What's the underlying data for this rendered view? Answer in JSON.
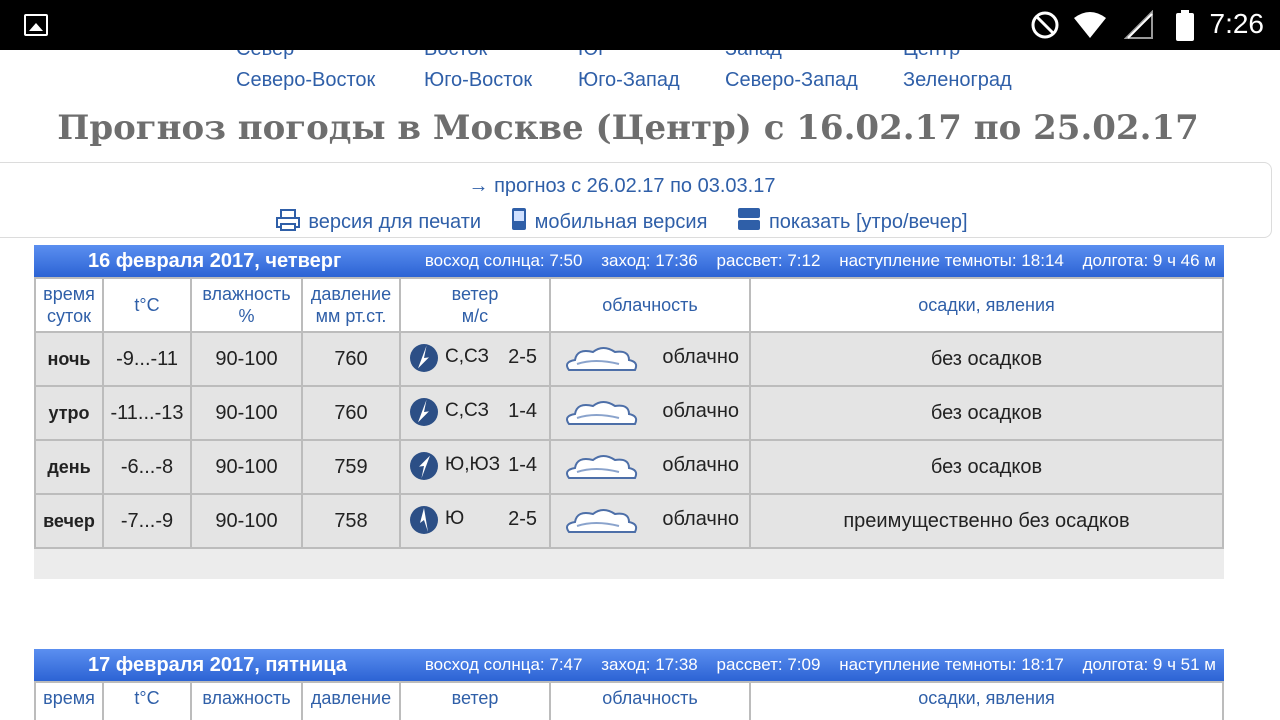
{
  "statusbar": {
    "time": "7:26"
  },
  "districts": [
    "Север",
    "Восток",
    "Юг",
    "Запад",
    "Центр",
    "Северо-Восток",
    "Юго-Восток",
    "Юго-Запад",
    "Северо-Запад",
    "Зеленоград"
  ],
  "title": "Прогноз погоды в Москве (Центр) с 16.02.17 по 25.02.17",
  "next_link": "→ прогноз с 26.02.17 по 03.03.17",
  "links": {
    "print": "версия для печати",
    "mobile": "мобильная версия",
    "show": "показать [утро/вечер]"
  },
  "headers": {
    "time1": "время",
    "time2": "суток",
    "temp": "t°C",
    "hum1": "влажность",
    "hum2": "%",
    "press1": "давление",
    "press2": "мм рт.ст.",
    "wind1": "ветер",
    "wind2": "м/с",
    "cloud": "облачность",
    "precip": "осадки, явления"
  },
  "days": [
    {
      "date": "16 февраля 2017, четверг",
      "sunrise": "восход солнца: 7:50",
      "sunset": "заход: 17:36",
      "dawn": "рассвет: 7:12",
      "dark": "наступление темноты: 18:14",
      "length": "долгота: 9 ч 46 м",
      "rows": [
        {
          "tod": "ночь",
          "temp": "-9...-11",
          "hum": "90-100",
          "press": "760",
          "dir": "С,СЗ",
          "speed": "2-5",
          "cloud": "облачно",
          "precip": "без осадков"
        },
        {
          "tod": "утро",
          "temp": "-11...-13",
          "hum": "90-100",
          "press": "760",
          "dir": "С,СЗ",
          "speed": "1-4",
          "cloud": "облачно",
          "precip": "без осадков"
        },
        {
          "tod": "день",
          "temp": "-6...-8",
          "hum": "90-100",
          "press": "759",
          "dir": "Ю,ЮЗ",
          "speed": "1-4",
          "cloud": "облачно",
          "precip": "без осадков"
        },
        {
          "tod": "вечер",
          "temp": "-7...-9",
          "hum": "90-100",
          "press": "758",
          "dir": "Ю",
          "speed": "2-5",
          "cloud": "облачно",
          "precip": "преимущественно без осадков"
        }
      ]
    },
    {
      "date": "17 февраля 2017, пятница",
      "sunrise": "восход солнца: 7:47",
      "sunset": "заход: 17:38",
      "dawn": "рассвет: 7:09",
      "dark": "наступление темноты: 18:17",
      "length": "долгота: 9 ч 51 м"
    }
  ]
}
